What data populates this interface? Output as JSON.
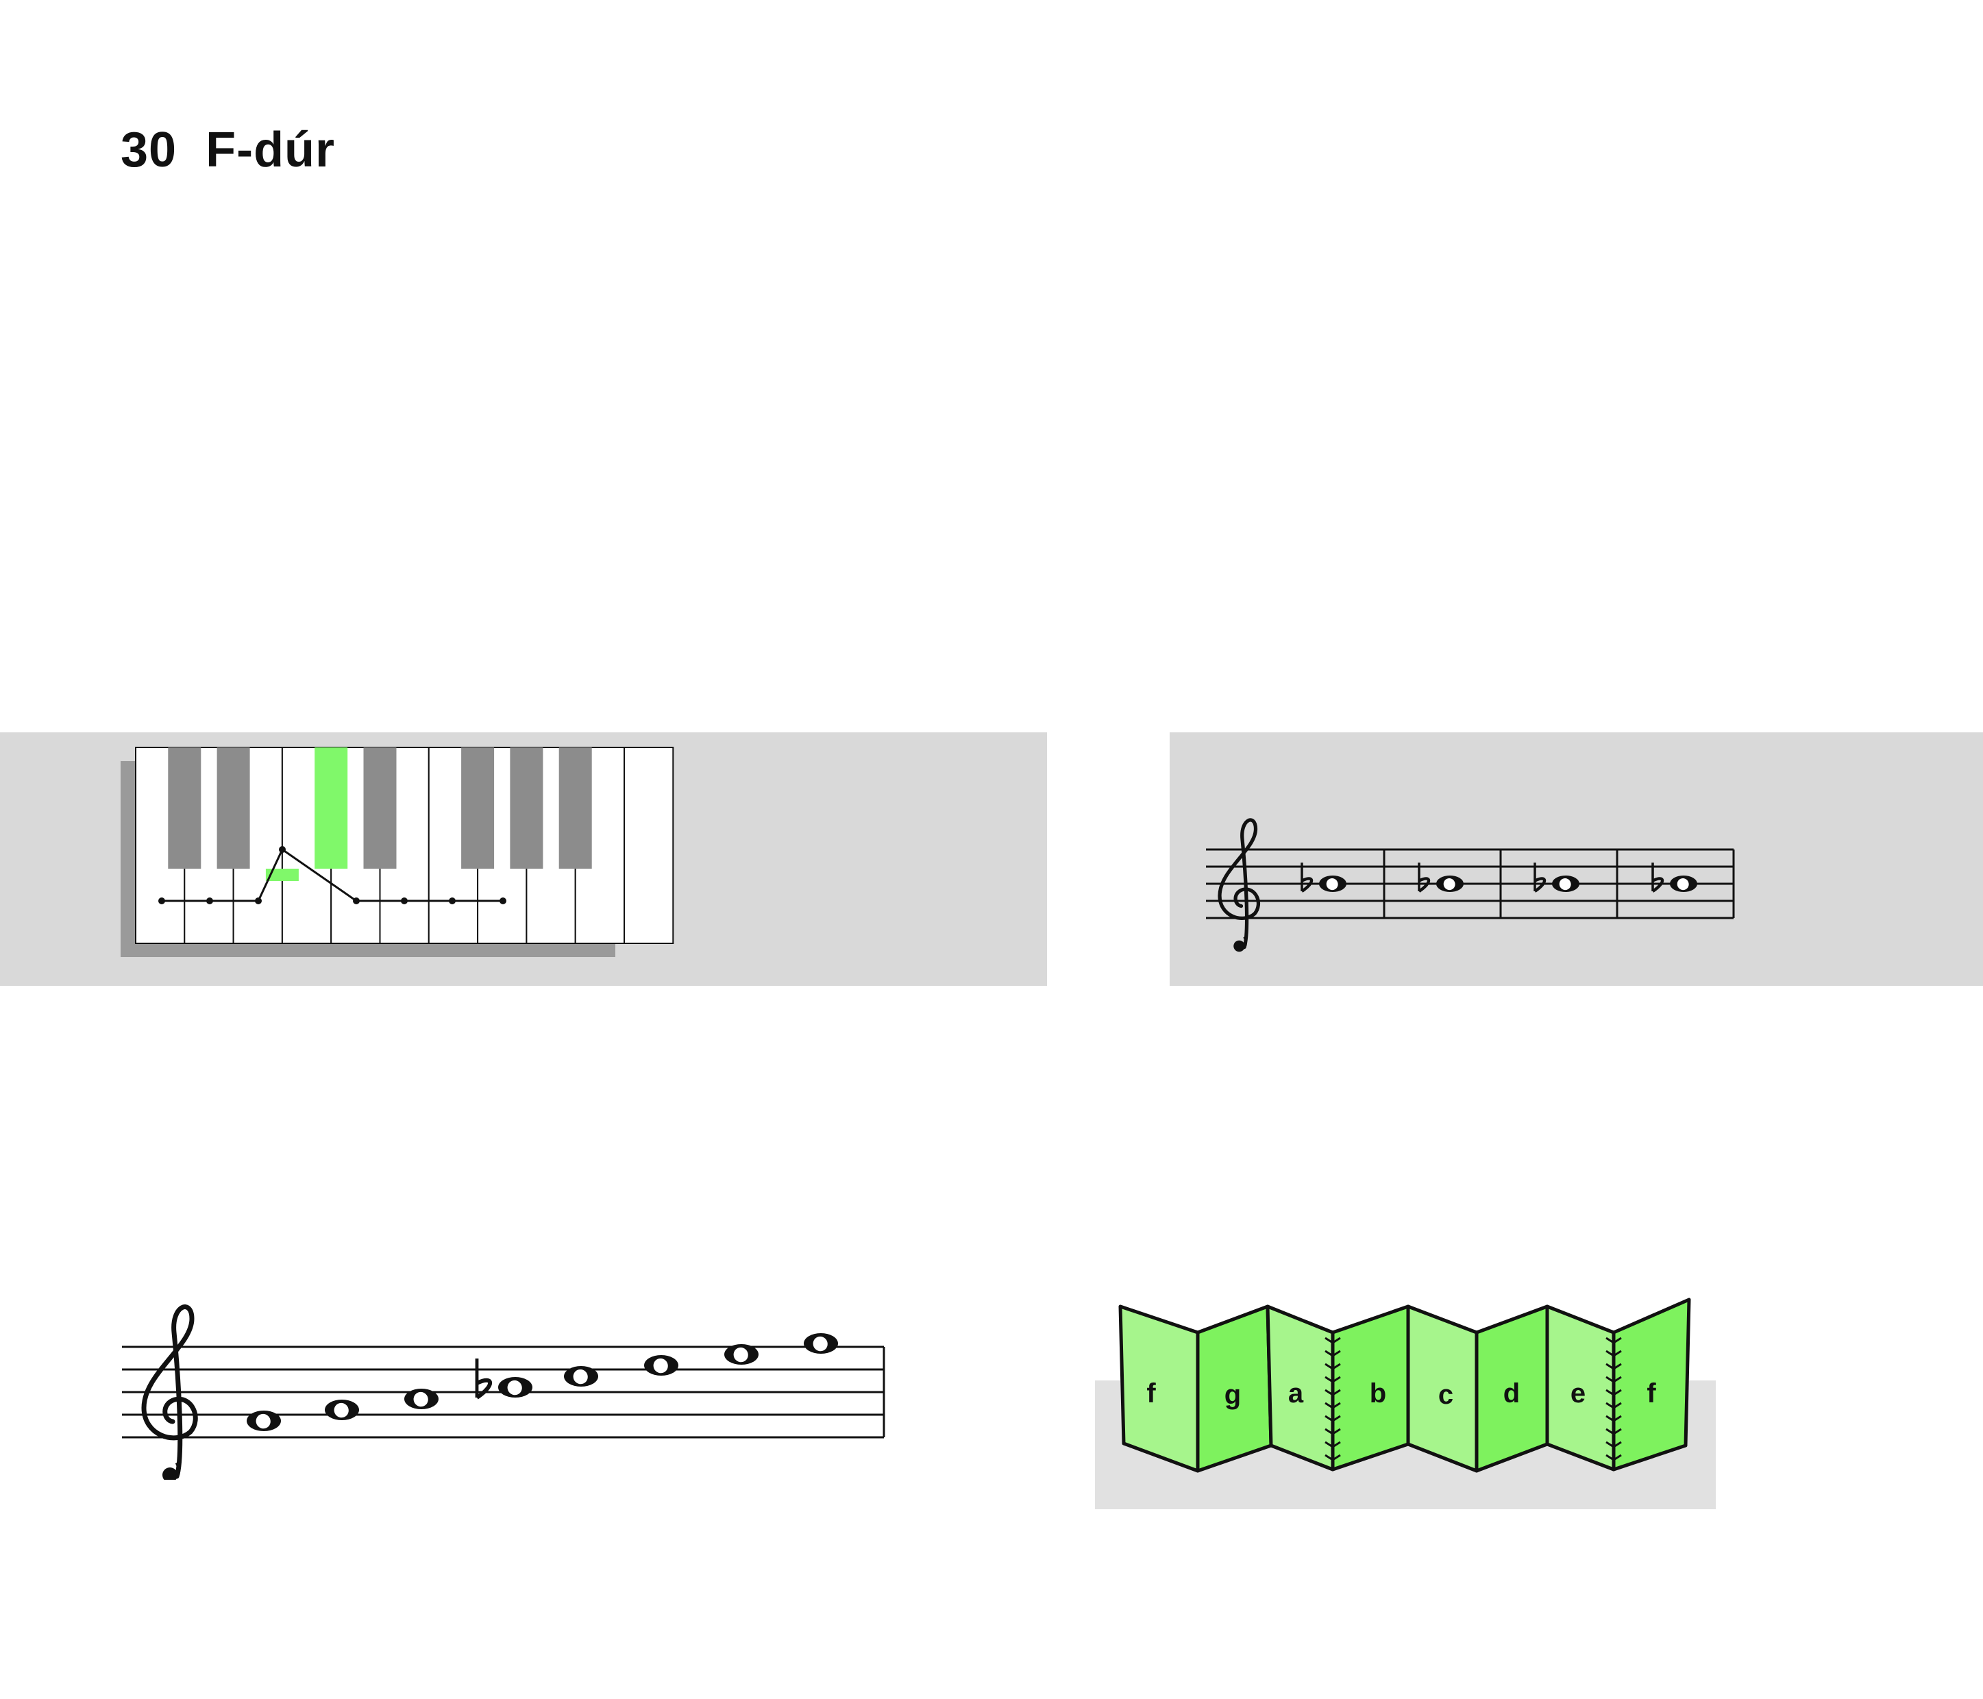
{
  "page": {
    "number": "30",
    "title": "F-dúr"
  },
  "keyboard": {
    "white_key_count": 11,
    "black_key_groups": [
      [
        1,
        2
      ],
      [
        4,
        5
      ],
      [
        7,
        8,
        9
      ]
    ],
    "highlighted_black_key": "b",
    "highlight_color": "#80f86a",
    "black_key_color": "#8c8c8c"
  },
  "measures_staff": {
    "clef": "treble",
    "measures": [
      {
        "accidental": "♭",
        "note": "b"
      },
      {
        "accidental": "♭",
        "note": "b"
      },
      {
        "accidental": "♭",
        "note": "b"
      },
      {
        "accidental": "♭",
        "note": "b"
      }
    ]
  },
  "scale_staff": {
    "clef": "treble",
    "notes": [
      {
        "name": "f",
        "accidental": ""
      },
      {
        "name": "g",
        "accidental": ""
      },
      {
        "name": "a",
        "accidental": ""
      },
      {
        "name": "b",
        "accidental": "♭"
      },
      {
        "name": "c",
        "accidental": ""
      },
      {
        "name": "d",
        "accidental": ""
      },
      {
        "name": "e",
        "accidental": ""
      },
      {
        "name": "f",
        "accidental": ""
      }
    ]
  },
  "leporello": {
    "labels": [
      "f",
      "g",
      "a",
      "b",
      "c",
      "d",
      "e",
      "f"
    ],
    "colors": {
      "light": "#a6f58c",
      "dark": "#7ef25e"
    }
  }
}
